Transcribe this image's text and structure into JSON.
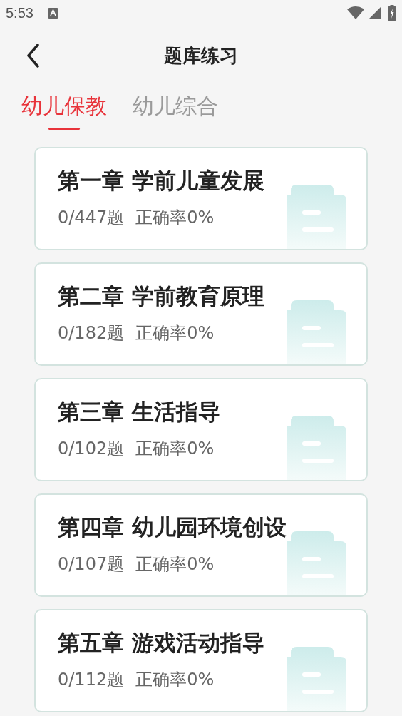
{
  "status_bar": {
    "time": "5:53"
  },
  "header": {
    "title": "题库练习"
  },
  "tabs": [
    {
      "label": "幼儿保教",
      "selected": true
    },
    {
      "label": "幼儿综合",
      "selected": false
    }
  ],
  "chapters": [
    {
      "title": "第一章 学前儿童发展",
      "count": "0/447题",
      "accuracy": "正确率0%"
    },
    {
      "title": "第二章 学前教育原理",
      "count": "0/182题",
      "accuracy": "正确率0%"
    },
    {
      "title": "第三章 生活指导",
      "count": "0/102题",
      "accuracy": "正确率0%"
    },
    {
      "title": "第四章 幼儿园环境创设",
      "count": "0/107题",
      "accuracy": "正确率0%"
    },
    {
      "title": "第五章 游戏活动指导",
      "count": "0/112题",
      "accuracy": "正确率0%"
    }
  ]
}
